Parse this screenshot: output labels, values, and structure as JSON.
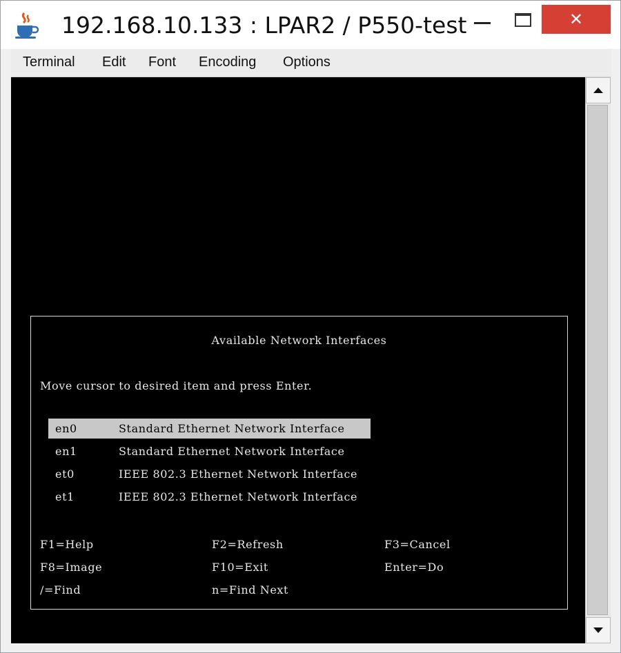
{
  "window": {
    "title": "192.168.10.133 : LPAR2 / P550-test",
    "controls": {
      "minimize": "—",
      "maximize": "",
      "close": "✕"
    }
  },
  "menubar": {
    "items": [
      "Terminal",
      "Edit",
      "Font",
      "Encoding",
      "Options"
    ]
  },
  "dialog": {
    "title": "Available Network Interfaces",
    "instruction": "Move cursor to desired item and press Enter.",
    "items": [
      {
        "name": "en0",
        "description": "Standard Ethernet Network Interface",
        "selected": true
      },
      {
        "name": "en1",
        "description": "Standard Ethernet Network Interface",
        "selected": false
      },
      {
        "name": "et0",
        "description": "IEEE 802.3 Ethernet Network Interface",
        "selected": false
      },
      {
        "name": "et1",
        "description": "IEEE 802.3 Ethernet Network Interface",
        "selected": false
      }
    ],
    "keys": [
      [
        "F1=Help",
        "F2=Refresh",
        "F3=Cancel"
      ],
      [
        "F8=Image",
        "F10=Exit",
        "Enter=Do"
      ],
      [
        "/=Find",
        "n=Find Next",
        ""
      ]
    ]
  },
  "icons": {
    "app": "java-cup-icon",
    "scroll_up": "scroll-up-arrow-icon",
    "scroll_down": "scroll-down-arrow-icon"
  },
  "colors": {
    "terminal_bg": "#000000",
    "terminal_text": "#e6e6e6",
    "selection_bg": "#c8c8c8",
    "close_button": "#d53f34"
  }
}
